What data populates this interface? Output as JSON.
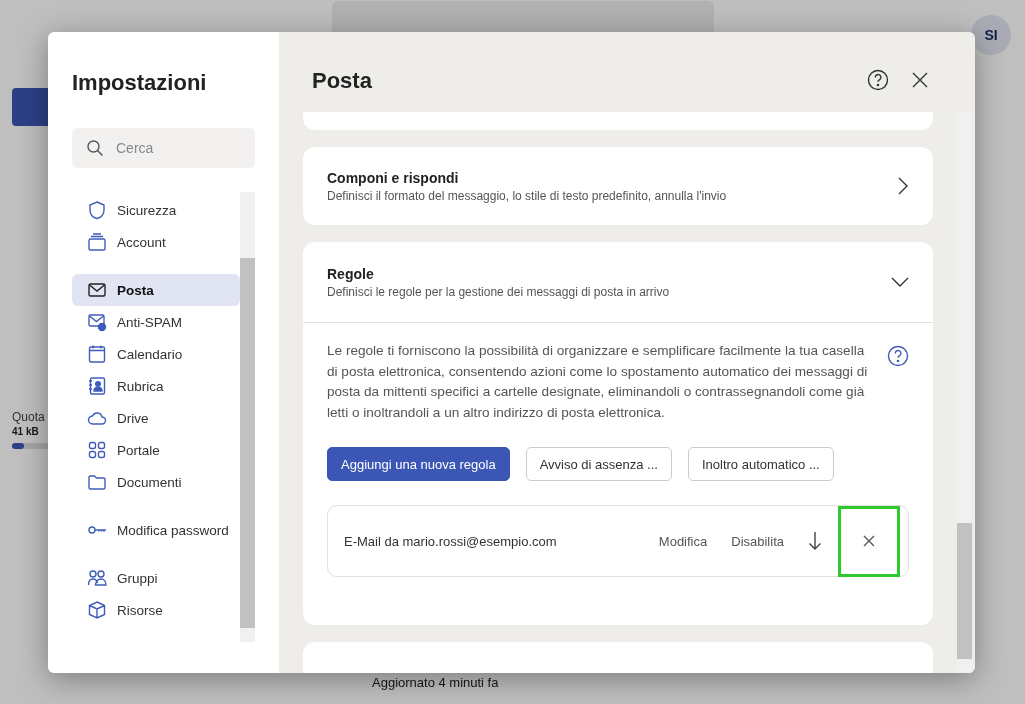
{
  "app": {
    "avatar": "SI",
    "quota_label": "Quota",
    "quota_value": "41 kB",
    "status": "Aggiornato 4 minuti fa"
  },
  "settings": {
    "title": "Impostazioni",
    "search": {
      "placeholder": "Cerca"
    },
    "nav_groups": [
      [
        {
          "label": "Sicurezza",
          "kind": "shield",
          "selected": false
        },
        {
          "label": "Account",
          "kind": "account",
          "selected": false
        }
      ],
      [
        {
          "label": "Posta",
          "kind": "mail",
          "selected": true
        },
        {
          "label": "Anti-SPAM",
          "kind": "spam",
          "selected": false
        },
        {
          "label": "Calendario",
          "kind": "calendar",
          "selected": false
        },
        {
          "label": "Rubrica",
          "kind": "contacts",
          "selected": false
        },
        {
          "label": "Drive",
          "kind": "cloud",
          "selected": false
        },
        {
          "label": "Portale",
          "kind": "grid",
          "selected": false
        },
        {
          "label": "Documenti",
          "kind": "folder",
          "selected": false
        }
      ],
      [
        {
          "label": "Modifica password",
          "kind": "key",
          "selected": false
        }
      ],
      [
        {
          "label": "Gruppi",
          "kind": "people",
          "selected": false
        },
        {
          "label": "Risorse",
          "kind": "cube",
          "selected": false
        }
      ]
    ]
  },
  "panel": {
    "title": "Posta",
    "sections": [
      {
        "title": "Componi e rispondi",
        "description": "Definisci il formato del messaggio, lo stile di testo predefinito, annulla l'invio",
        "expanded": false
      },
      {
        "title": "Regole",
        "description": "Definisci le regole per la gestione dei messaggi di posta in arrivo",
        "expanded": true,
        "body": "Le regole ti forniscono la possibilità di organizzare e semplificare facilmente la tua casella di posta elettronica, consentendo azioni come lo spostamento automatico dei messaggi di posta da mittenti specifici a cartelle designate, eliminandoli o contrassegnandoli come già letti o inoltrandoli a un altro indirizzo di posta elettronica.",
        "buttons": [
          {
            "label": "Aggiungi una nuova regola",
            "kind": "primary"
          },
          {
            "label": "Avviso di assenza ...",
            "kind": "secondary"
          },
          {
            "label": "Inoltro automatico ...",
            "kind": "secondary"
          }
        ],
        "rules": [
          {
            "name": "E-Mail da mario.rossi@esempio.com",
            "edit": "Modifica",
            "disable": "Disabilita",
            "delete_highlighted": true
          }
        ]
      }
    ]
  }
}
